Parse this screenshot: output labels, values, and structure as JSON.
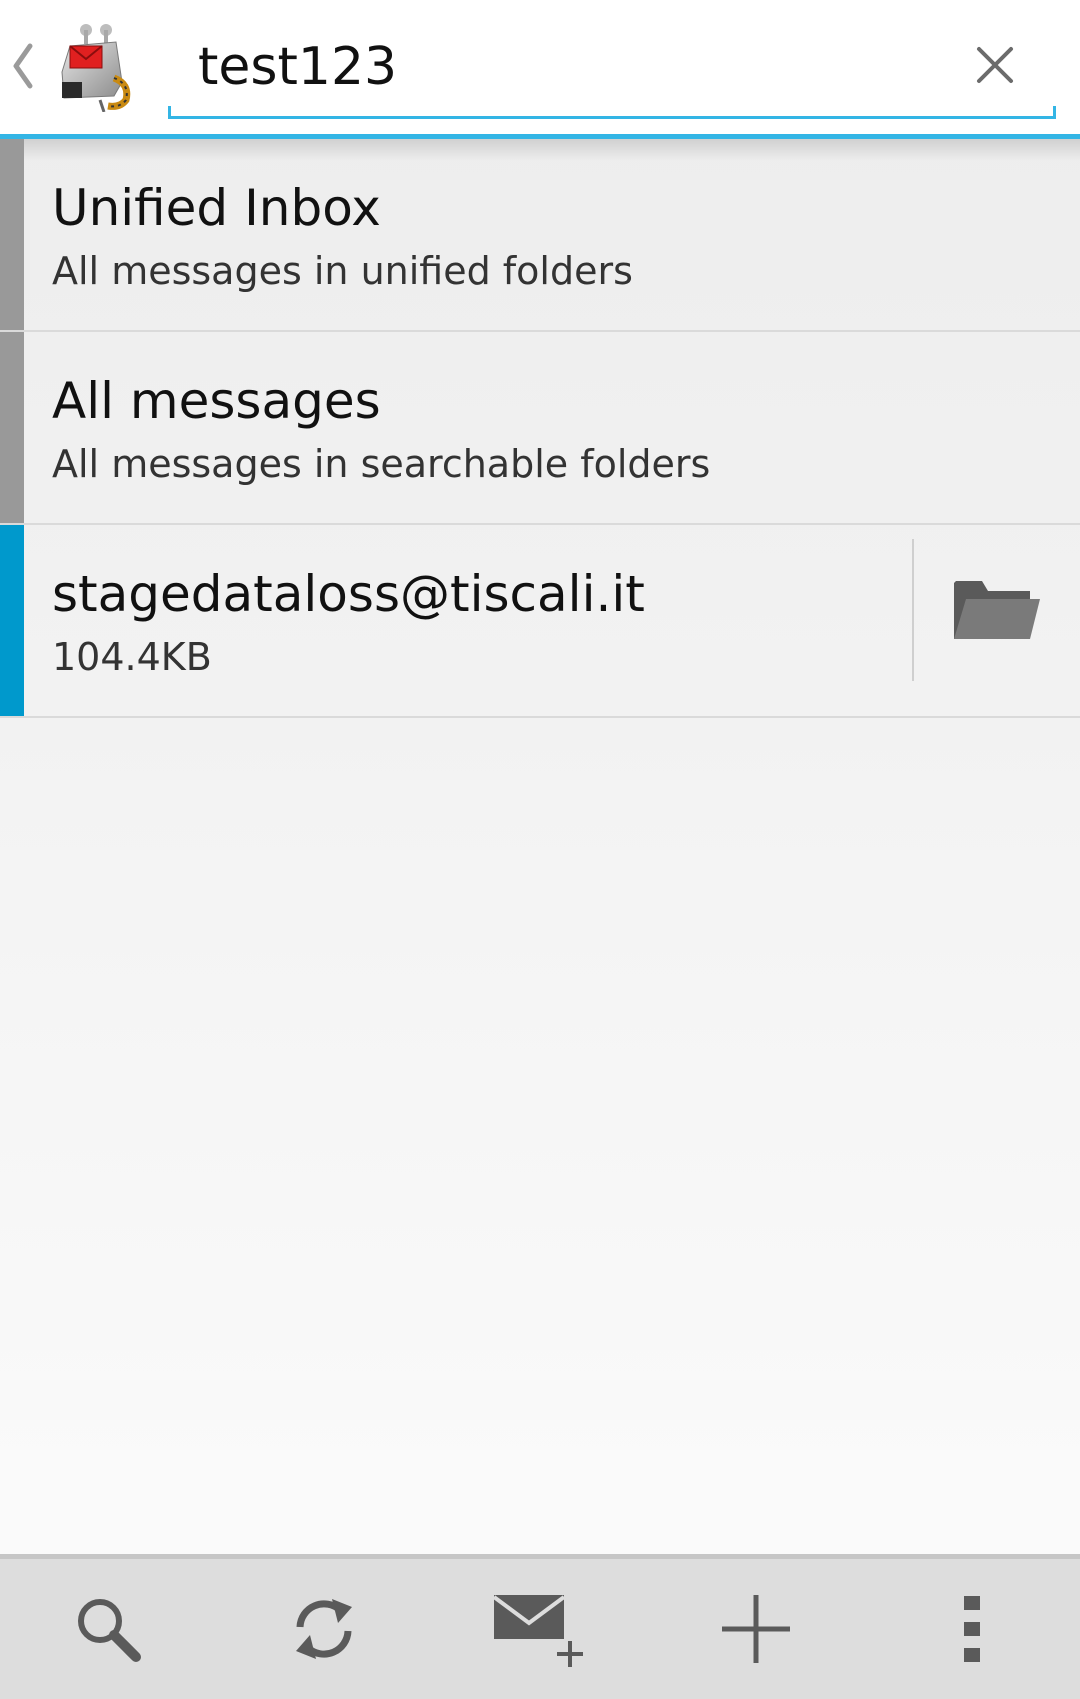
{
  "search": {
    "value": "test123",
    "placeholder": ""
  },
  "colors": {
    "accent": "#33b5e5",
    "unified_chip": "#999999",
    "account_chip": "#0099cc",
    "icon_gray": "#5a5a5a"
  },
  "accounts": [
    {
      "title": "Unified Inbox",
      "subtitle": "All messages in unified folders",
      "chip_color": "#999999",
      "has_folder_button": false
    },
    {
      "title": "All messages",
      "subtitle": "All messages in searchable folders",
      "chip_color": "#999999",
      "has_folder_button": false
    },
    {
      "title": "stagedataloss@tiscali.it",
      "subtitle": "104.4KB",
      "chip_color": "#0099cc",
      "has_folder_button": true
    }
  ],
  "icons": {
    "back": "chevron-left-icon",
    "logo": "k9-mail-logo",
    "clear": "close-icon",
    "folder": "folder-icon",
    "bottom_bar": [
      "search-icon",
      "refresh-icon",
      "compose-icon",
      "add-icon",
      "overflow-menu-icon"
    ]
  }
}
